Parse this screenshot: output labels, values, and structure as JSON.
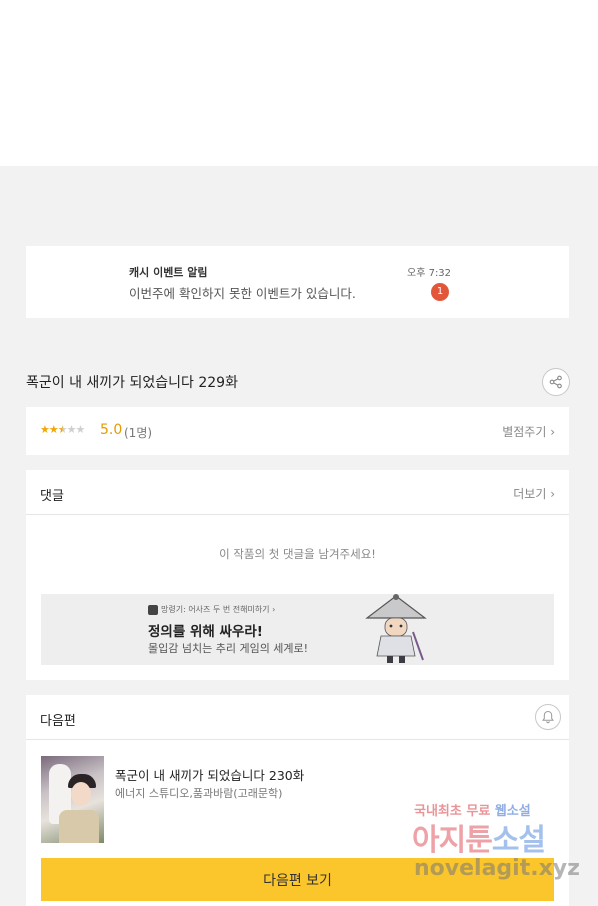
{
  "notification": {
    "title": "캐시 이벤트 알림",
    "message": "이번주에 확인하지 못한 이벤트가 있습니다.",
    "time": "오후 7:32",
    "badge_count": "1"
  },
  "episode": {
    "title": "폭군이 내 새끼가 되었습니다 229화",
    "share_icon": "share-icon"
  },
  "rating": {
    "stars_filled": 2.5,
    "stars_total": 5,
    "score": "5.0",
    "count": "(1명)",
    "rate_link": "별점주기 ›",
    "accent_color": "#f0a800"
  },
  "comments": {
    "header": "댓글",
    "more_link": "더보기 ›",
    "empty_message": "이 작품의 첫 댓글을 남겨주세요!",
    "ad": {
      "small_text": "망령기: 어사즈 두 번 전해미하기 ›",
      "title": "정의를 위해 싸우라!",
      "subtitle": "몰입감 넘치는 추리 게임의 세계로!"
    }
  },
  "next_episode": {
    "header": "다음편",
    "bell_icon": "bell-icon",
    "title": "폭군이 내 새끼가 되었습니다 230화",
    "author": "에너지 스튜디오,품과바람(고래문학)",
    "button_label": "다음편 보기",
    "button_color": "#fbc62b"
  },
  "watermark": {
    "line1_a": "국내최초 무료",
    "line1_b": "웹소설",
    "line2_a": "아지툰",
    "line2_b": "소설",
    "line3": "novelagit.xyz"
  }
}
